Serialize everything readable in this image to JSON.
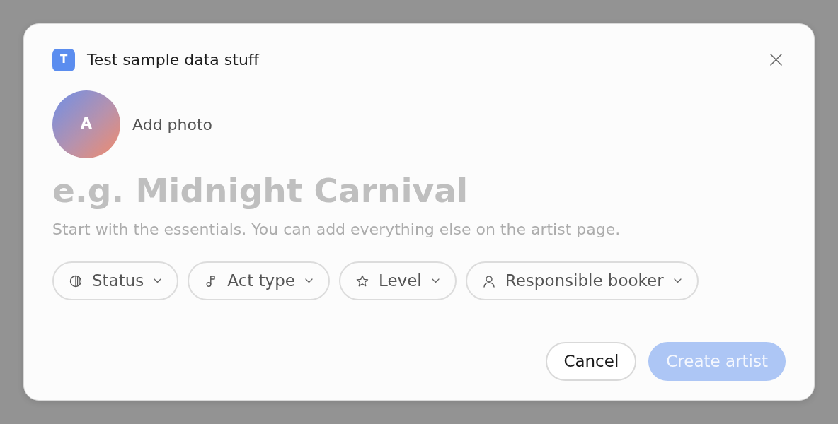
{
  "dialog": {
    "workspace": {
      "initial": "T",
      "name": "Test sample data stuff"
    },
    "photo": {
      "initial": "A",
      "label": "Add photo"
    },
    "name_field": {
      "placeholder": "e.g. Midnight Carnival"
    },
    "hint": "Start with the essentials. You can add everything else on the artist page.",
    "chips": [
      {
        "kind": "status",
        "label": "Status"
      },
      {
        "kind": "act_type",
        "label": "Act type"
      },
      {
        "kind": "level",
        "label": "Level"
      },
      {
        "kind": "booker",
        "label": "Responsible booker"
      }
    ],
    "buttons": [
      {
        "kind": "secondary",
        "label": "Cancel",
        "disabled": false
      },
      {
        "kind": "primary",
        "label": "Create artist",
        "disabled": true
      }
    ]
  }
}
